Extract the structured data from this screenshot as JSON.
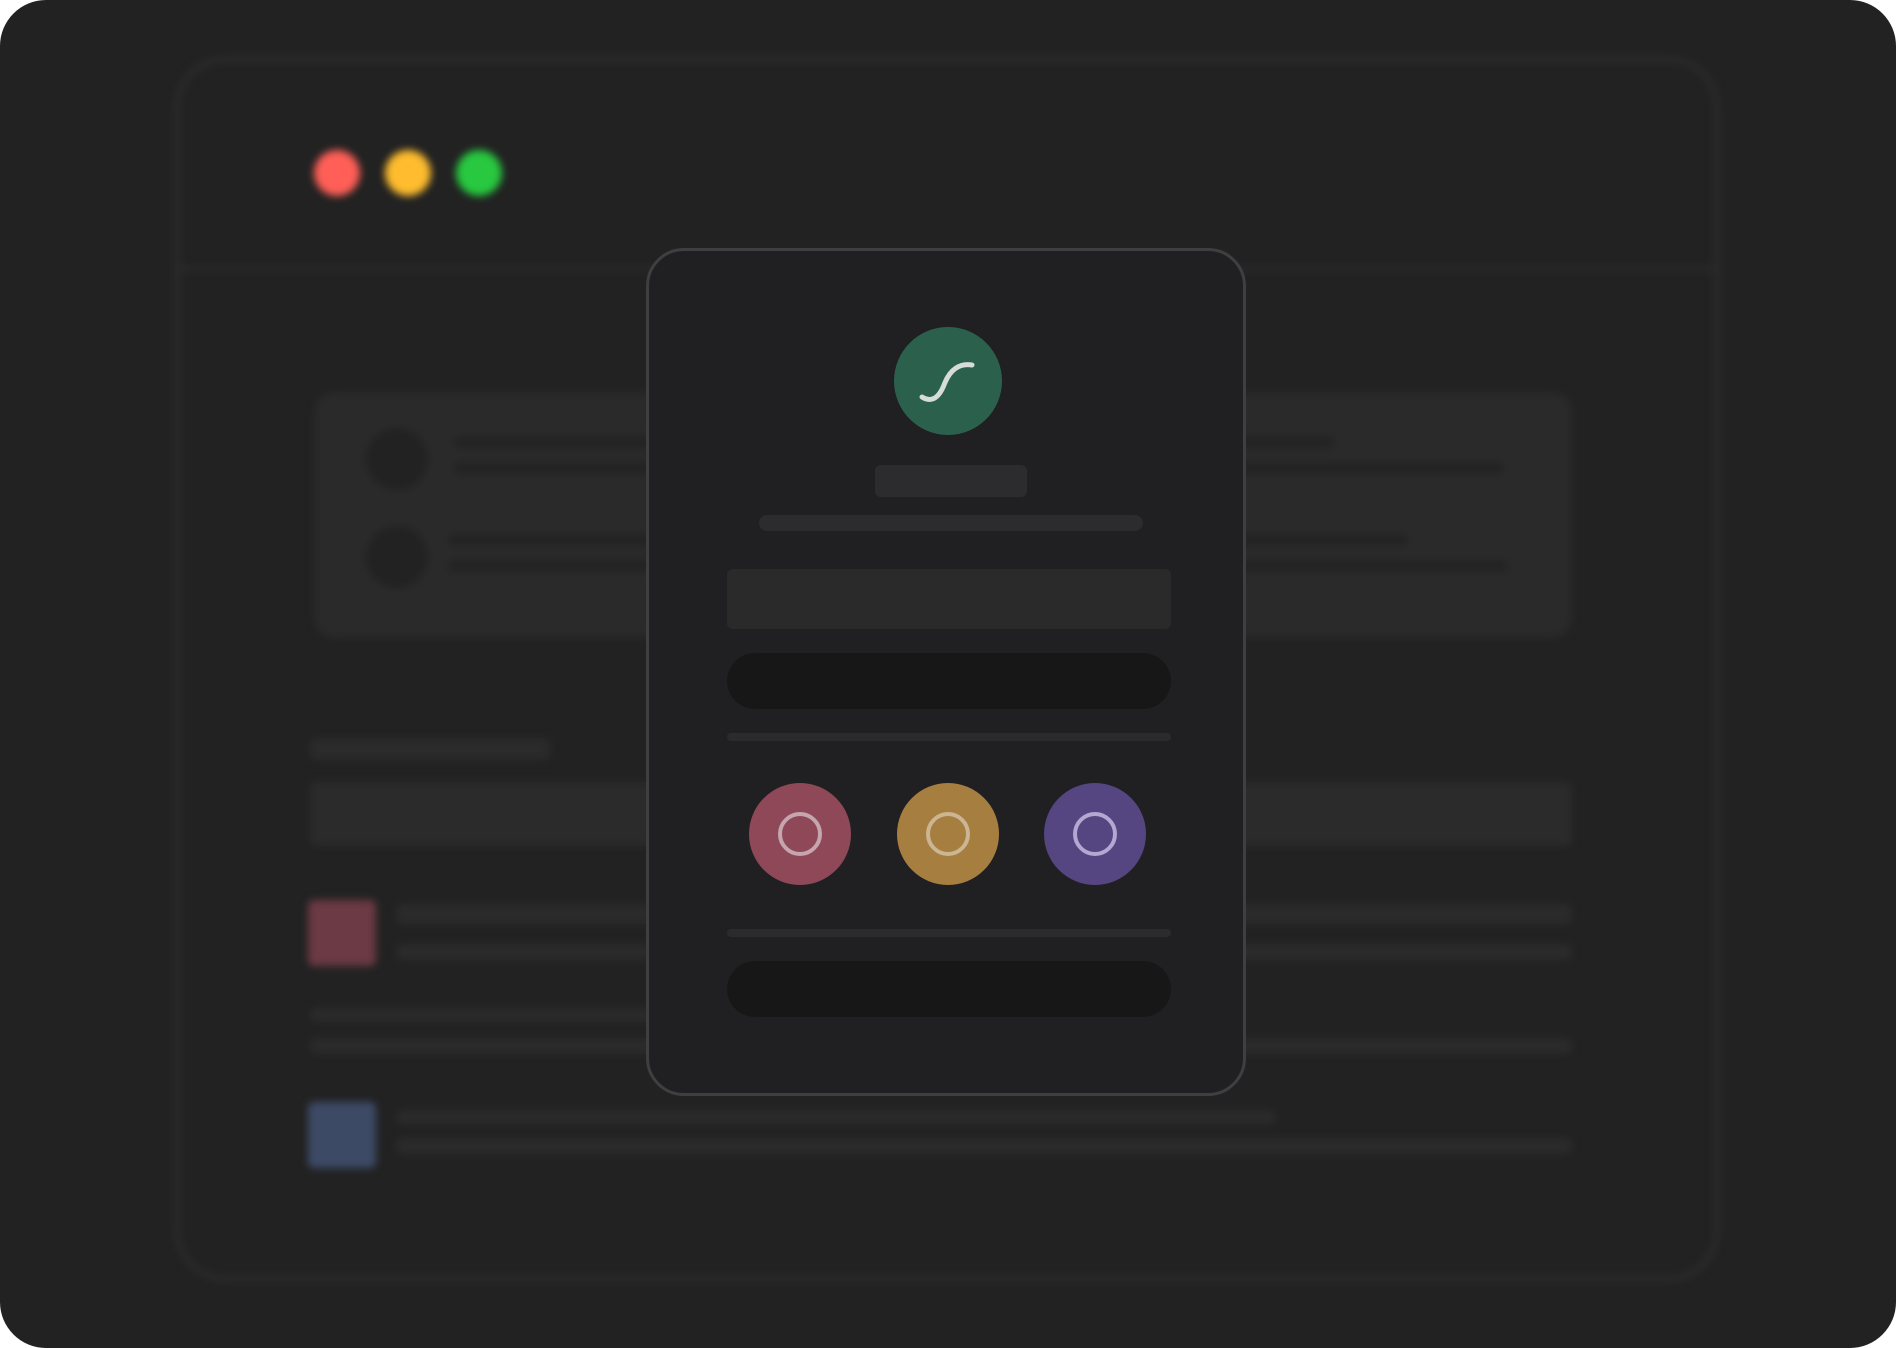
{
  "background_window": {
    "traffic_lights": [
      {
        "name": "close",
        "color": "#ff5f57"
      },
      {
        "name": "minimize",
        "color": "#febc2e"
      },
      {
        "name": "maximize",
        "color": "#28c840"
      }
    ],
    "attachment_colors": [
      "#6b3a44",
      "#3d4a66"
    ]
  },
  "dialog": {
    "logo_icon": "curve-icon",
    "logo_color": "#2b614c",
    "title": "",
    "subtitle": "",
    "input_value": "",
    "primary_button_label": "",
    "secondary_button_label": "",
    "options": [
      {
        "name": "option-red",
        "color": "#8e4858",
        "icon": "circle-outline-icon"
      },
      {
        "name": "option-amber",
        "color": "#a67e40",
        "icon": "circle-outline-icon"
      },
      {
        "name": "option-purple",
        "color": "#554580",
        "icon": "circle-outline-icon"
      }
    ]
  }
}
